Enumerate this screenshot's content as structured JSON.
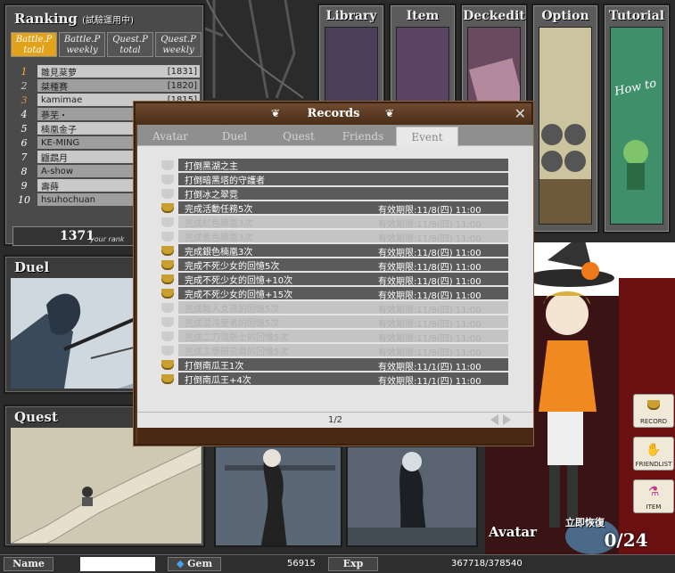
{
  "ranking": {
    "title": "Ranking",
    "subtitle": "(試驗運用中)",
    "tabs": [
      {
        "line1": "Battle.P",
        "line2": "total"
      },
      {
        "line1": "Battle.P",
        "line2": "weekly"
      },
      {
        "line1": "Quest.P",
        "line2": "total"
      },
      {
        "line1": "Quest.P",
        "line2": "weekly"
      }
    ],
    "rows": [
      {
        "rank": "1",
        "name": "雛見棻萝",
        "score": "[1831]"
      },
      {
        "rank": "2",
        "name": "桀種赛",
        "score": "[1820]"
      },
      {
        "rank": "3",
        "name": "kamimae",
        "score": "[1815]"
      },
      {
        "rank": "4",
        "name": "蔘芜・",
        "score": ""
      },
      {
        "rank": "5",
        "name": "楠凰金子",
        "score": ""
      },
      {
        "rank": "6",
        "name": "KE-MING",
        "score": ""
      },
      {
        "rank": "7",
        "name": "鼴鵡月",
        "score": ""
      },
      {
        "rank": "8",
        "name": "A-show",
        "score": ""
      },
      {
        "rank": "9",
        "name": "壽蒔",
        "score": ""
      },
      {
        "rank": "10",
        "name": "hsuhochuan",
        "score": ""
      }
    ],
    "your_rank_value": "1371",
    "your_rank_label": "your rank"
  },
  "panels": {
    "duel": "Duel",
    "quest": "Quest",
    "avatar": "Avatar"
  },
  "menu": [
    "Library",
    "Item",
    "Deckedit",
    "Option",
    "Tutorial"
  ],
  "tutorial_sign": "How to",
  "records": {
    "title": "Records",
    "tabs": [
      "Avatar",
      "Duel",
      "Quest",
      "Friends",
      "Event"
    ],
    "active_tab": "Event",
    "items": [
      {
        "text": "打倒黑湖之主",
        "expiry": "",
        "cup": "gray",
        "dim": false
      },
      {
        "text": "打倒暗黑塔的守護者",
        "expiry": "",
        "cup": "gray",
        "dim": false
      },
      {
        "text": "打倒冰之翠霓",
        "expiry": "",
        "cup": "gray",
        "dim": false
      },
      {
        "text": "完成活動任務5次",
        "expiry": "有效期限:11/8(四) 11:00",
        "cup": "gold",
        "dim": false
      },
      {
        "text": "完成紅色楠凰3次",
        "expiry": "有效期限:11/8(四) 11:00",
        "cup": "gray",
        "dim": true
      },
      {
        "text": "完成藍色楠凰3次",
        "expiry": "有效期限:11/8(四) 11:00",
        "cup": "gray",
        "dim": true
      },
      {
        "text": "完成銀色楠凰3次",
        "expiry": "有效期限:11/8(四) 11:00",
        "cup": "gold",
        "dim": false
      },
      {
        "text": "完成不死少女的回憶5次",
        "expiry": "有效期限:11/8(四) 11:00",
        "cup": "gold",
        "dim": false
      },
      {
        "text": "完成不死少女的回憶+10次",
        "expiry": "有效期限:11/8(四) 11:00",
        "cup": "gold",
        "dim": false
      },
      {
        "text": "完成不死少女的回憶+15次",
        "expiry": "有效期限:11/8(四) 11:00",
        "cup": "gold",
        "dim": false
      },
      {
        "text": "完成骷人女孩的回憶5次",
        "expiry": "有效期限:11/8(四) 11:00",
        "cup": "gray",
        "dim": true
      },
      {
        "text": "完成混沌使者的回憶5次",
        "expiry": "有效期限:11/8(四) 11:00",
        "cup": "gray",
        "dim": true
      },
      {
        "text": "完成二刀流劍士的回憶5次",
        "expiry": "有效期限:11/8(四) 11:00",
        "cup": "gray",
        "dim": true
      },
      {
        "text": "完成工學研究員的回憶5次",
        "expiry": "有效期限:11/8(四) 11:00",
        "cup": "gray",
        "dim": true
      },
      {
        "text": "打倒南瓜王1次",
        "expiry": "有效期限:11/1(四) 11:00",
        "cup": "gold",
        "dim": false
      },
      {
        "text": "打倒南瓜王+4次",
        "expiry": "有效期限:11/1(四) 11:00",
        "cup": "gold",
        "dim": false
      }
    ],
    "pagination": "1/2"
  },
  "side_buttons": [
    "RECORD",
    "FRIENDLIST",
    "ITEM"
  ],
  "recover_button": "立即恢復",
  "counter": "0/24",
  "bottom": {
    "name_label": "Name",
    "gem_label": "Gem",
    "gem_value": "56915",
    "exp_label": "Exp",
    "exp_value": "367718/378540"
  },
  "colors": {
    "accent_tab": "#e2a21a",
    "modal_frame": "#5d3a22",
    "gold_cup": "#c9a030"
  }
}
